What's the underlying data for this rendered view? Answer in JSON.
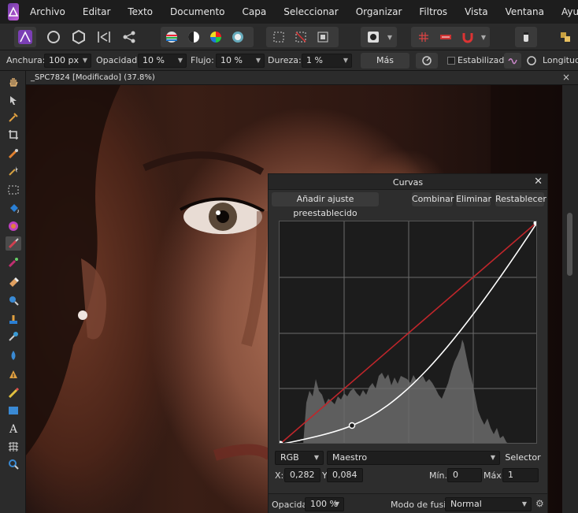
{
  "app": {
    "menu": [
      "Archivo",
      "Editar",
      "Texto",
      "Documento",
      "Capa",
      "Seleccionar",
      "Organizar",
      "Filtros",
      "Vista",
      "Ventana",
      "Ayuda"
    ]
  },
  "context_bar": {
    "width_label": "Anchura:",
    "width_value": "100 px",
    "opacity_label": "Opacidad:",
    "opacity_value": "10 %",
    "flow_label": "Flujo:",
    "flow_value": "10 %",
    "hardness_label": "Dureza:",
    "hardness_value": "1 %",
    "more_label": "Más",
    "stabilizer_label": "Estabilizador",
    "length_label": "Longitud:"
  },
  "document": {
    "tab_title": "_SPC7824 [Modificado] (37.8%)",
    "close_glyph": "×"
  },
  "curves_panel": {
    "title": "Curvas",
    "close_glyph": "✕",
    "add_preset_label": "Añadir ajuste preestablecido",
    "merge_label": "Combinar",
    "delete_label": "Eliminar",
    "reset_label": "Restablecer",
    "colour_space": "RGB",
    "channel": "Maestro",
    "picker_label": "Selector",
    "x_label": "X:",
    "x_value": "0,282",
    "y_label": "Y:",
    "y_value": "0,084",
    "min_label": "Mín.:",
    "min_value": "0",
    "max_label": "Máx.:",
    "max_value": "1",
    "opacity_label": "Opacidad:",
    "opacity_value": "100 %",
    "blend_label": "Modo de fusión:",
    "blend_value": "Normal",
    "curve_points": [
      [
        0,
        0
      ],
      [
        0.282,
        0.084
      ],
      [
        1,
        1
      ]
    ],
    "colors": {
      "curve": "#ffffff",
      "diagonal": "#c0262b",
      "histogram": "#6a6a6a"
    }
  }
}
